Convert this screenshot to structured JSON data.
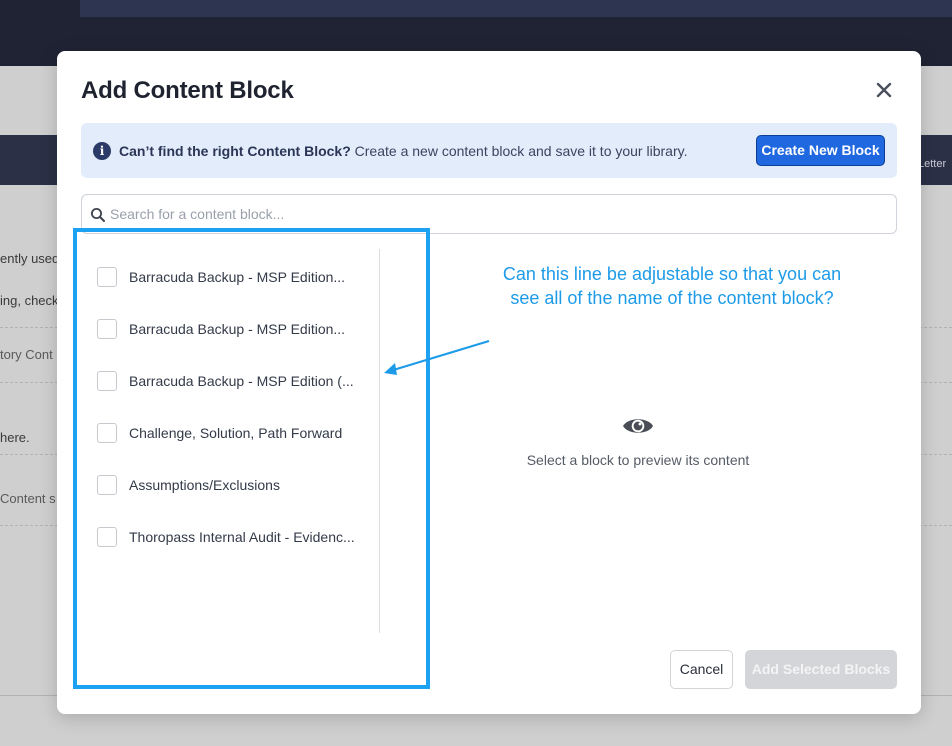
{
  "background": {
    "fragments": [
      "ently used",
      "ing, check",
      "tory Cont",
      "here.",
      "Content s"
    ],
    "right_edge_label": "Letter"
  },
  "modal": {
    "title": "Add Content Block",
    "close_icon": "close-icon",
    "banner": {
      "icon": "info-icon",
      "icon_glyph": "i",
      "bold_text": "Can’t find the right Content Block?",
      "text": " Create a new content block and save it to your library.",
      "button_label": "Create New Block"
    },
    "search": {
      "icon": "search-icon",
      "placeholder": "Search for a content block...",
      "value": ""
    },
    "blocks": [
      {
        "label": "Barracuda Backup - MSP Edition...",
        "checked": false
      },
      {
        "label": "Barracuda Backup - MSP Edition...",
        "checked": false
      },
      {
        "label": "Barracuda Backup - MSP Edition (...",
        "checked": false
      },
      {
        "label": "Challenge, Solution, Path Forward",
        "checked": false
      },
      {
        "label": "Assumptions/Exclusions",
        "checked": false
      },
      {
        "label": "Thoropass Internal Audit - Evidenc...",
        "checked": false
      }
    ],
    "preview": {
      "icon": "eye-icon",
      "text": "Select a block to preview its content"
    },
    "footer": {
      "cancel_label": "Cancel",
      "add_label": "Add Selected Blocks"
    }
  },
  "annotation": {
    "text": "Can this line be adjustable so that you can see all of the name of the content block?",
    "color": "#1da1f2"
  },
  "colors": {
    "primary": "#1f68e0",
    "banner_bg": "#e2ecfb",
    "disabled": "#d4d5d8"
  }
}
